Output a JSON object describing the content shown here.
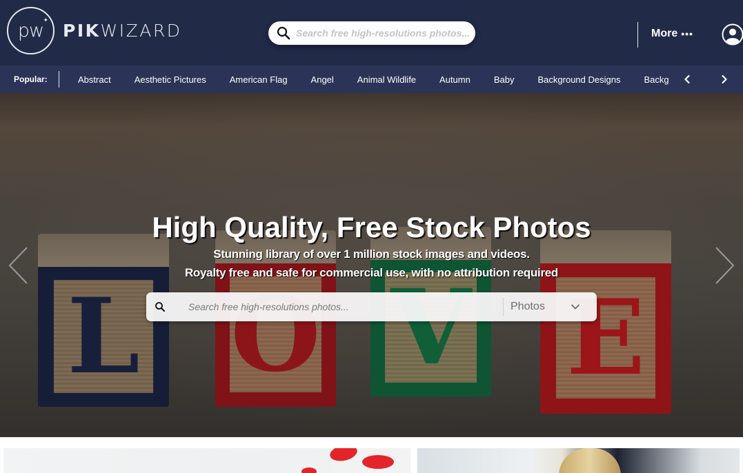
{
  "header": {
    "logo": {
      "monogram": "pw",
      "brand_bold": "PIK",
      "brand_light": "WIZARD"
    },
    "search": {
      "placeholder": "Search free high-resolutions photos...",
      "icon": "search-icon"
    },
    "more_label": "More",
    "more_icon": "ellipsis-icon",
    "user_icon": "user-circle-icon"
  },
  "popular": {
    "label": "Popular:",
    "tags": [
      "Abstract",
      "Aesthetic Pictures",
      "American Flag",
      "Angel",
      "Animal Wildlife",
      "Autumn",
      "Baby",
      "Background Designs",
      "Backgrounds"
    ],
    "prev_icon": "chevron-left-icon",
    "next_icon": "chevron-right-icon"
  },
  "hero": {
    "title": "High Quality, Free Stock Photos",
    "subtitle_1": "Stunning library of over 1 million stock images and videos.",
    "subtitle_2": "Royalty free and safe for commercial use, with no attribution required",
    "background_letters": [
      "L",
      "O",
      "V",
      "E"
    ],
    "search": {
      "placeholder": "Search free high-resolutions photos...",
      "type_selected": "Photos"
    },
    "prev_icon": "chevron-left-icon",
    "next_icon": "chevron-right-icon"
  },
  "colors": {
    "header_bg": "#212a47",
    "popular_bg": "#2b3456",
    "text_light": "#ffffff"
  }
}
